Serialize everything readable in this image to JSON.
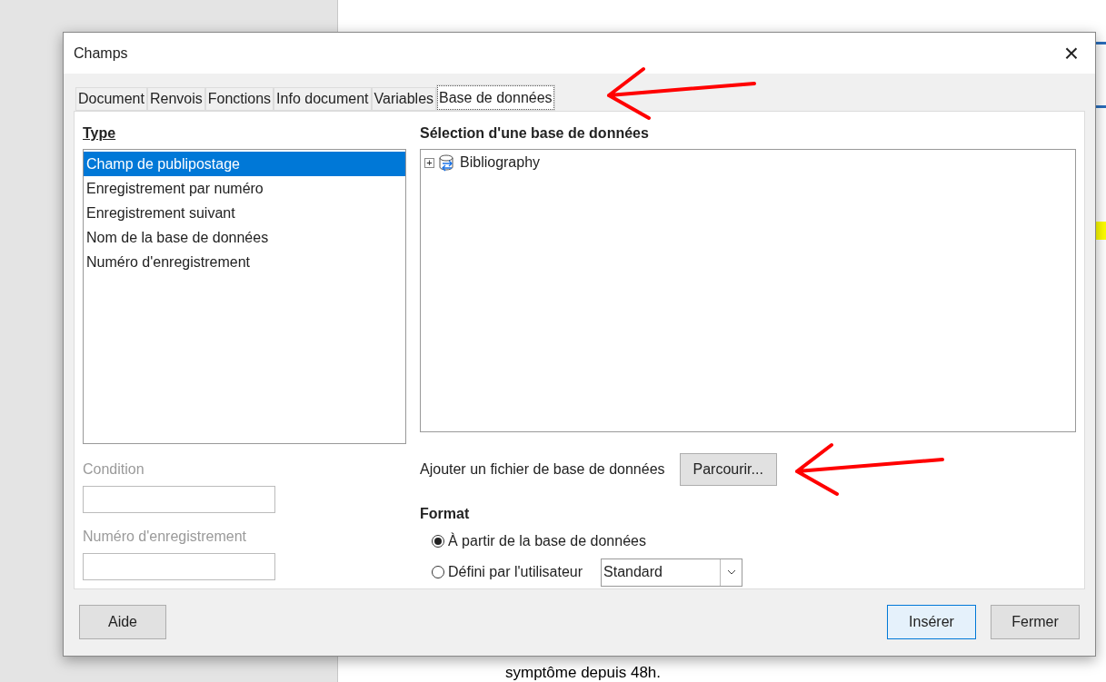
{
  "document": {
    "last_line": "symptôme depuis 48h."
  },
  "window": {
    "title": "Champs",
    "close": "×"
  },
  "tabs": [
    {
      "label": "Document",
      "selected": false
    },
    {
      "label": "Renvois",
      "selected": false
    },
    {
      "label": "Fonctions",
      "selected": false
    },
    {
      "label": "Info document",
      "selected": false
    },
    {
      "label": "Variables",
      "selected": false
    },
    {
      "label": "Base de données",
      "selected": true
    }
  ],
  "type": {
    "heading": "Type",
    "items": [
      {
        "label": "Champ de publipostage",
        "selected": true
      },
      {
        "label": "Enregistrement par numéro",
        "selected": false
      },
      {
        "label": "Enregistrement suivant",
        "selected": false
      },
      {
        "label": "Nom de la base de données",
        "selected": false
      },
      {
        "label": "Numéro d'enregistrement",
        "selected": false
      }
    ]
  },
  "condition": {
    "label": "Condition",
    "disabled": true
  },
  "record_number": {
    "label": "Numéro d'enregistrement",
    "disabled": true
  },
  "database": {
    "heading": "Sélection d'une base de données",
    "tree": [
      {
        "label": "Bibliography",
        "expand": "+",
        "expanded": false
      }
    ]
  },
  "add_file": {
    "label": "Ajouter un fichier de base de données",
    "button": "Parcourir..."
  },
  "format": {
    "heading": "Format",
    "options": [
      {
        "label": "À partir de la base de données",
        "selected": true
      },
      {
        "label": "Défini par l'utilisateur",
        "selected": false
      }
    ],
    "select": "Standard"
  },
  "buttons": {
    "help": "Aide",
    "insert": "Insérer",
    "close": "Fermer"
  }
}
